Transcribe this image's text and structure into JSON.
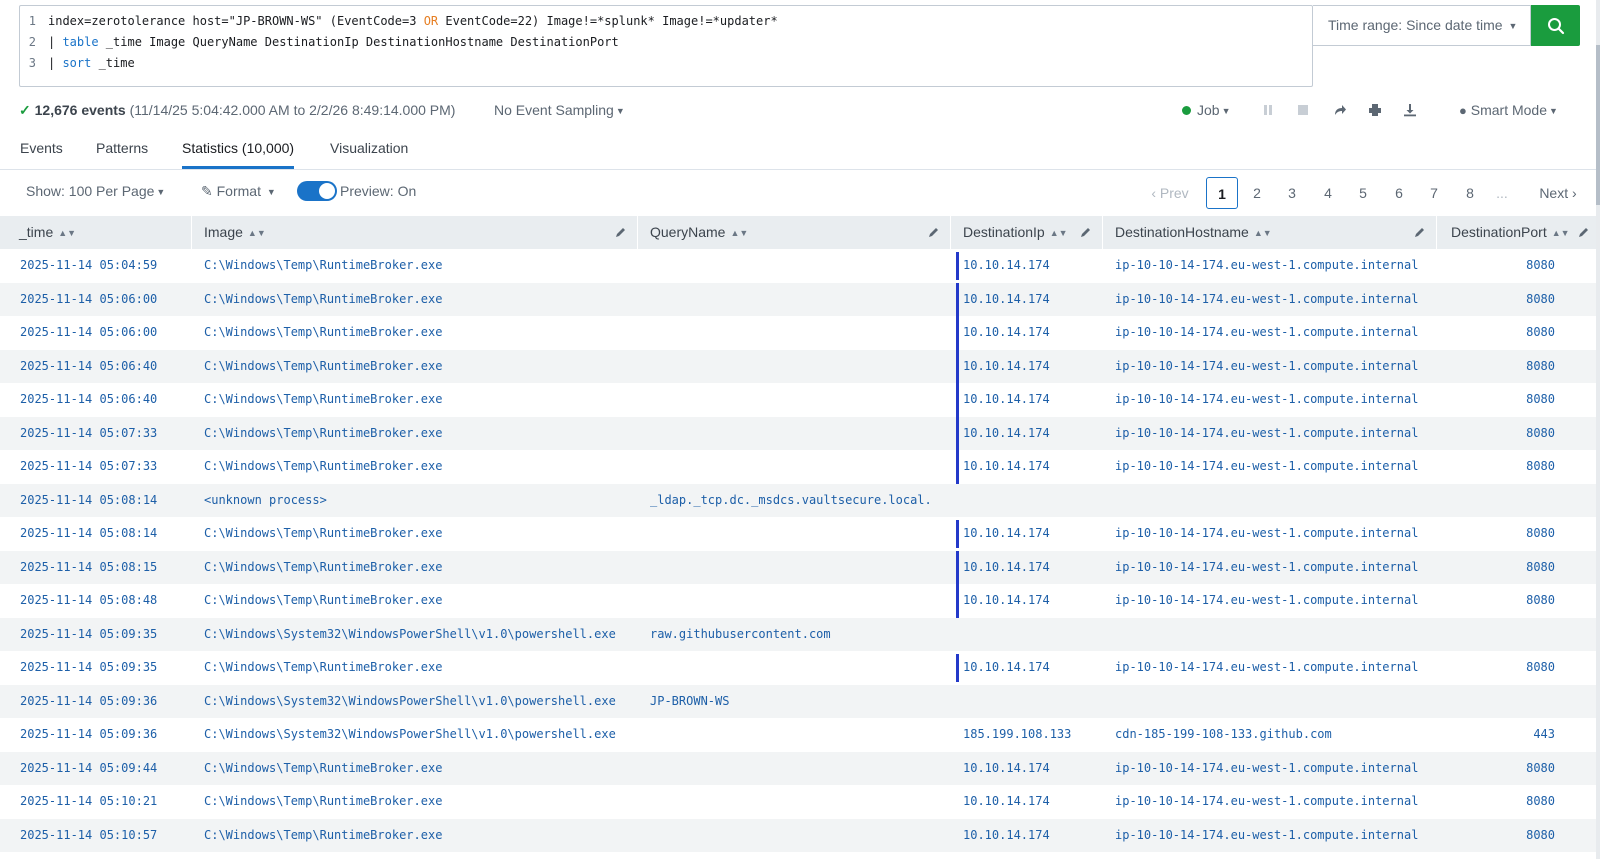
{
  "search": {
    "lines": [
      {
        "num": "1",
        "parts": [
          "index=zerotolerance host=\"JP-BROWN-WS\" (EventCode=3 ",
          "OR",
          " EventCode=22) Image!=*splunk* Image!=*updater*"
        ]
      },
      {
        "num": "2",
        "parts": [
          "| ",
          "table",
          " _time Image QueryName DestinationIp DestinationHostname DestinationPort"
        ]
      },
      {
        "num": "3",
        "parts": [
          "| ",
          "sort",
          " _time"
        ]
      }
    ],
    "time_range_label": "Time range: Since date time"
  },
  "status": {
    "event_count": "12,676 events",
    "event_range": "(11/14/25 5:04:42.000 AM to 2/2/26 8:49:14.000 PM)",
    "sampling": "No Event Sampling",
    "job": "Job",
    "mode": "Smart Mode"
  },
  "tabs": [
    "Events",
    "Patterns",
    "Statistics (10,000)",
    "Visualization"
  ],
  "controls": {
    "per_page": "Show: 100 Per Page",
    "format": "Format",
    "preview": "Preview: On",
    "prev": "Prev",
    "next": "Next",
    "pages": [
      "1",
      "2",
      "3",
      "4",
      "5",
      "6",
      "7",
      "8"
    ],
    "ellipsis": "..."
  },
  "columns": [
    "_time",
    "Image",
    "QueryName",
    "DestinationIp",
    "DestinationHostname",
    "DestinationPort"
  ],
  "rows": [
    {
      "time": "2025-11-14 05:04:59",
      "image": "C:\\Windows\\Temp\\RuntimeBroker.exe",
      "query": "",
      "ip": "10.10.14.174",
      "host": "ip-10-10-14-174.eu-west-1.compute.internal",
      "port": "8080"
    },
    {
      "time": "2025-11-14 05:06:00",
      "image": "C:\\Windows\\Temp\\RuntimeBroker.exe",
      "query": "",
      "ip": "10.10.14.174",
      "host": "ip-10-10-14-174.eu-west-1.compute.internal",
      "port": "8080"
    },
    {
      "time": "2025-11-14 05:06:00",
      "image": "C:\\Windows\\Temp\\RuntimeBroker.exe",
      "query": "",
      "ip": "10.10.14.174",
      "host": "ip-10-10-14-174.eu-west-1.compute.internal",
      "port": "8080"
    },
    {
      "time": "2025-11-14 05:06:40",
      "image": "C:\\Windows\\Temp\\RuntimeBroker.exe",
      "query": "",
      "ip": "10.10.14.174",
      "host": "ip-10-10-14-174.eu-west-1.compute.internal",
      "port": "8080"
    },
    {
      "time": "2025-11-14 05:06:40",
      "image": "C:\\Windows\\Temp\\RuntimeBroker.exe",
      "query": "",
      "ip": "10.10.14.174",
      "host": "ip-10-10-14-174.eu-west-1.compute.internal",
      "port": "8080"
    },
    {
      "time": "2025-11-14 05:07:33",
      "image": "C:\\Windows\\Temp\\RuntimeBroker.exe",
      "query": "",
      "ip": "10.10.14.174",
      "host": "ip-10-10-14-174.eu-west-1.compute.internal",
      "port": "8080"
    },
    {
      "time": "2025-11-14 05:07:33",
      "image": "C:\\Windows\\Temp\\RuntimeBroker.exe",
      "query": "",
      "ip": "10.10.14.174",
      "host": "ip-10-10-14-174.eu-west-1.compute.internal",
      "port": "8080"
    },
    {
      "time": "2025-11-14 05:08:14",
      "image": "<unknown process>",
      "query": "_ldap._tcp.dc._msdcs.vaultsecure.local.",
      "ip": "",
      "host": "",
      "port": ""
    },
    {
      "time": "2025-11-14 05:08:14",
      "image": "C:\\Windows\\Temp\\RuntimeBroker.exe",
      "query": "",
      "ip": "10.10.14.174",
      "host": "ip-10-10-14-174.eu-west-1.compute.internal",
      "port": "8080"
    },
    {
      "time": "2025-11-14 05:08:15",
      "image": "C:\\Windows\\Temp\\RuntimeBroker.exe",
      "query": "",
      "ip": "10.10.14.174",
      "host": "ip-10-10-14-174.eu-west-1.compute.internal",
      "port": "8080"
    },
    {
      "time": "2025-11-14 05:08:48",
      "image": "C:\\Windows\\Temp\\RuntimeBroker.exe",
      "query": "",
      "ip": "10.10.14.174",
      "host": "ip-10-10-14-174.eu-west-1.compute.internal",
      "port": "8080"
    },
    {
      "time": "2025-11-14 05:09:35",
      "image": "C:\\Windows\\System32\\WindowsPowerShell\\v1.0\\powershell.exe",
      "query": "raw.githubusercontent.com",
      "ip": "",
      "host": "",
      "port": ""
    },
    {
      "time": "2025-11-14 05:09:35",
      "image": "C:\\Windows\\Temp\\RuntimeBroker.exe",
      "query": "",
      "ip": "10.10.14.174",
      "host": "ip-10-10-14-174.eu-west-1.compute.internal",
      "port": "8080"
    },
    {
      "time": "2025-11-14 05:09:36",
      "image": "C:\\Windows\\System32\\WindowsPowerShell\\v1.0\\powershell.exe",
      "query": "JP-BROWN-WS",
      "ip": "",
      "host": "",
      "port": ""
    },
    {
      "time": "2025-11-14 05:09:36",
      "image": "C:\\Windows\\System32\\WindowsPowerShell\\v1.0\\powershell.exe",
      "query": "",
      "ip": "185.199.108.133",
      "host": "cdn-185-199-108-133.github.com",
      "port": "443"
    },
    {
      "time": "2025-11-14 05:09:44",
      "image": "C:\\Windows\\Temp\\RuntimeBroker.exe",
      "query": "",
      "ip": "10.10.14.174",
      "host": "ip-10-10-14-174.eu-west-1.compute.internal",
      "port": "8080"
    },
    {
      "time": "2025-11-14 05:10:21",
      "image": "C:\\Windows\\Temp\\RuntimeBroker.exe",
      "query": "",
      "ip": "10.10.14.174",
      "host": "ip-10-10-14-174.eu-west-1.compute.internal",
      "port": "8080"
    },
    {
      "time": "2025-11-14 05:10:57",
      "image": "C:\\Windows\\Temp\\RuntimeBroker.exe",
      "query": "",
      "ip": "10.10.14.174",
      "host": "ip-10-10-14-174.eu-west-1.compute.internal",
      "port": "8080"
    }
  ],
  "colors": {
    "accent": "#1a73c8",
    "search_button": "#1a9c3e",
    "cell_link": "#1d5fa8",
    "ip_highlight": "#2339c9",
    "header_bg": "#e9edf0"
  }
}
